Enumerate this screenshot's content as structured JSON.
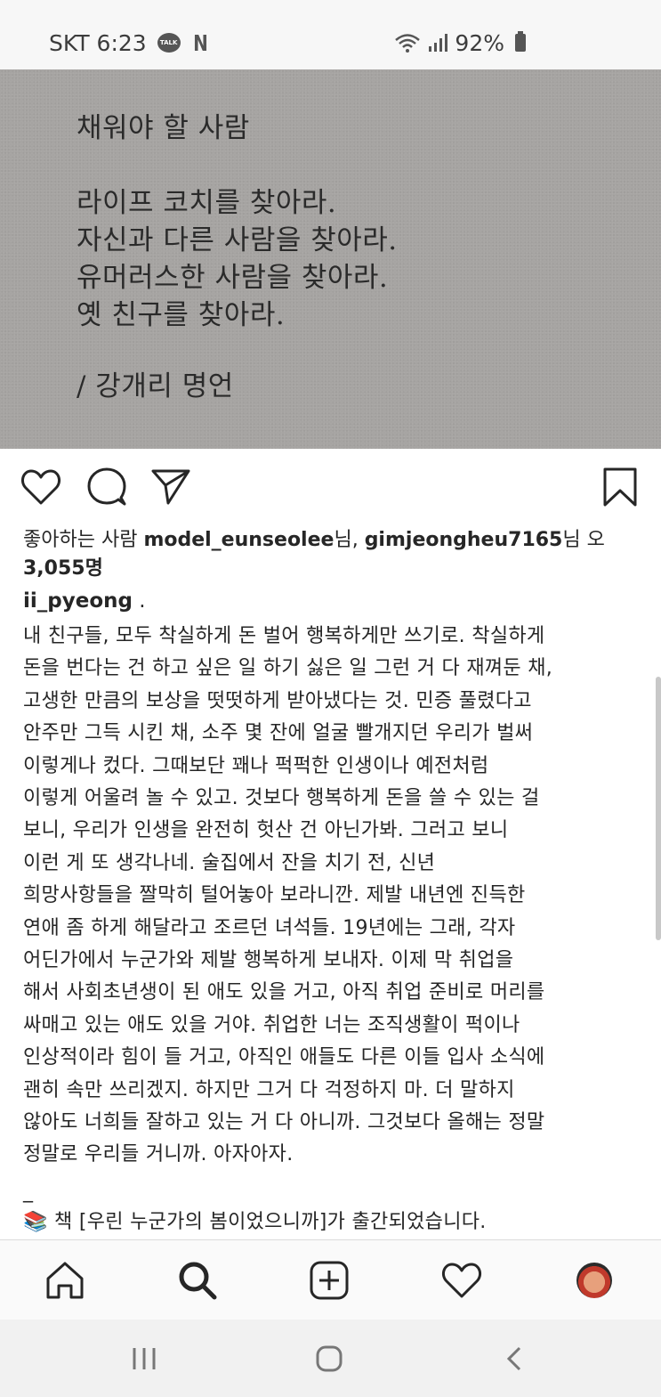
{
  "status_bar": {
    "carrier_time": "SKT 6:23",
    "talk_badge": "TALK",
    "netflix_icon": "N",
    "battery_percent": "92%",
    "icons": [
      "kakaotalk-icon",
      "netflix-icon",
      "wifi-icon",
      "signal-icon",
      "battery-icon"
    ]
  },
  "post_image": {
    "lines": [
      "채워야 할 사람",
      "라이프 코치를 찾아라.",
      "자신과 다른 사람을 찾아라.",
      "유머러스한 사람을 찾아라.",
      "옛 친구를 찾아라.",
      "/ 강개리 명언"
    ]
  },
  "actions": {
    "icons": [
      "heart-icon",
      "comment-icon",
      "share-icon",
      "bookmark-icon"
    ]
  },
  "likes": {
    "prefix": "좋아하는 사람 ",
    "user1": "model_eunseolee",
    "mid": "님, ",
    "user2": "gimjeongheu7165",
    "suffix": "님 오",
    "count": "3,055명"
  },
  "author": {
    "username": "ii_pyeong",
    "dot": " ."
  },
  "caption_lines": [
    "내 친구들, 모두 착실하게 돈 벌어 행복하게만 쓰기로. 착실하게",
    "돈을 번다는 건 하고 싶은 일 하기 싫은 일 그런 거 다 재껴둔 채,",
    "고생한 만큼의 보상을 떳떳하게 받아냈다는 것. 민증 풀렸다고",
    "안주만 그득 시킨 채, 소주 몇 잔에 얼굴 빨개지던 우리가 벌써",
    "이렇게나 컸다. 그때보단 꽤나 퍽퍽한 인생이나 예전처럼",
    "이렇게 어울려 놀 수 있고. 것보다 행복하게 돈을 쓸 수 있는 걸",
    "보니, 우리가 인생을 완전히 헛산 건 아닌가봐. 그러고 보니",
    "이런 게 또 생각나네. 술집에서 잔을 치기 전, 신년",
    "희망사항들을 짤막히 털어놓아 보라니깐. 제발 내년엔 진득한",
    "연애 좀 하게 해달라고 조르던 녀석들. 19년에는 그래, 각자",
    "어딘가에서 누군가와 제발 행복하게 보내자. 이제 막 취업을",
    "해서 사회초년생이 된 애도 있을 거고, 아직 취업 준비로 머리를",
    "싸매고 있는 애도 있을 거야. 취업한 너는 조직생활이 퍽이나",
    "인상적이라 힘이 들 거고, 아직인 애들도 다른 이들 입사 소식에",
    "괜히 속만 쓰리겠지. 하지만 그거 다 걱정하지 마. 더 말하지",
    "않아도 너희들 잘하고 있는 거 다 아니까. 그것보다 올해는 정말",
    "정말로 우리들 거니까. 아자아자."
  ],
  "caption_separator": "_",
  "book_line": {
    "emoji": "📚",
    "text": " 책 [우린 누군가의 봄이었으니까]가 출간되었습니다."
  },
  "bottom_nav": {
    "icons": [
      "home-icon",
      "search-icon",
      "add-post-icon",
      "activity-heart-icon",
      "profile-avatar"
    ]
  },
  "system_nav": {
    "icons": [
      "recent-apps-icon",
      "home-button-icon",
      "back-icon"
    ]
  }
}
